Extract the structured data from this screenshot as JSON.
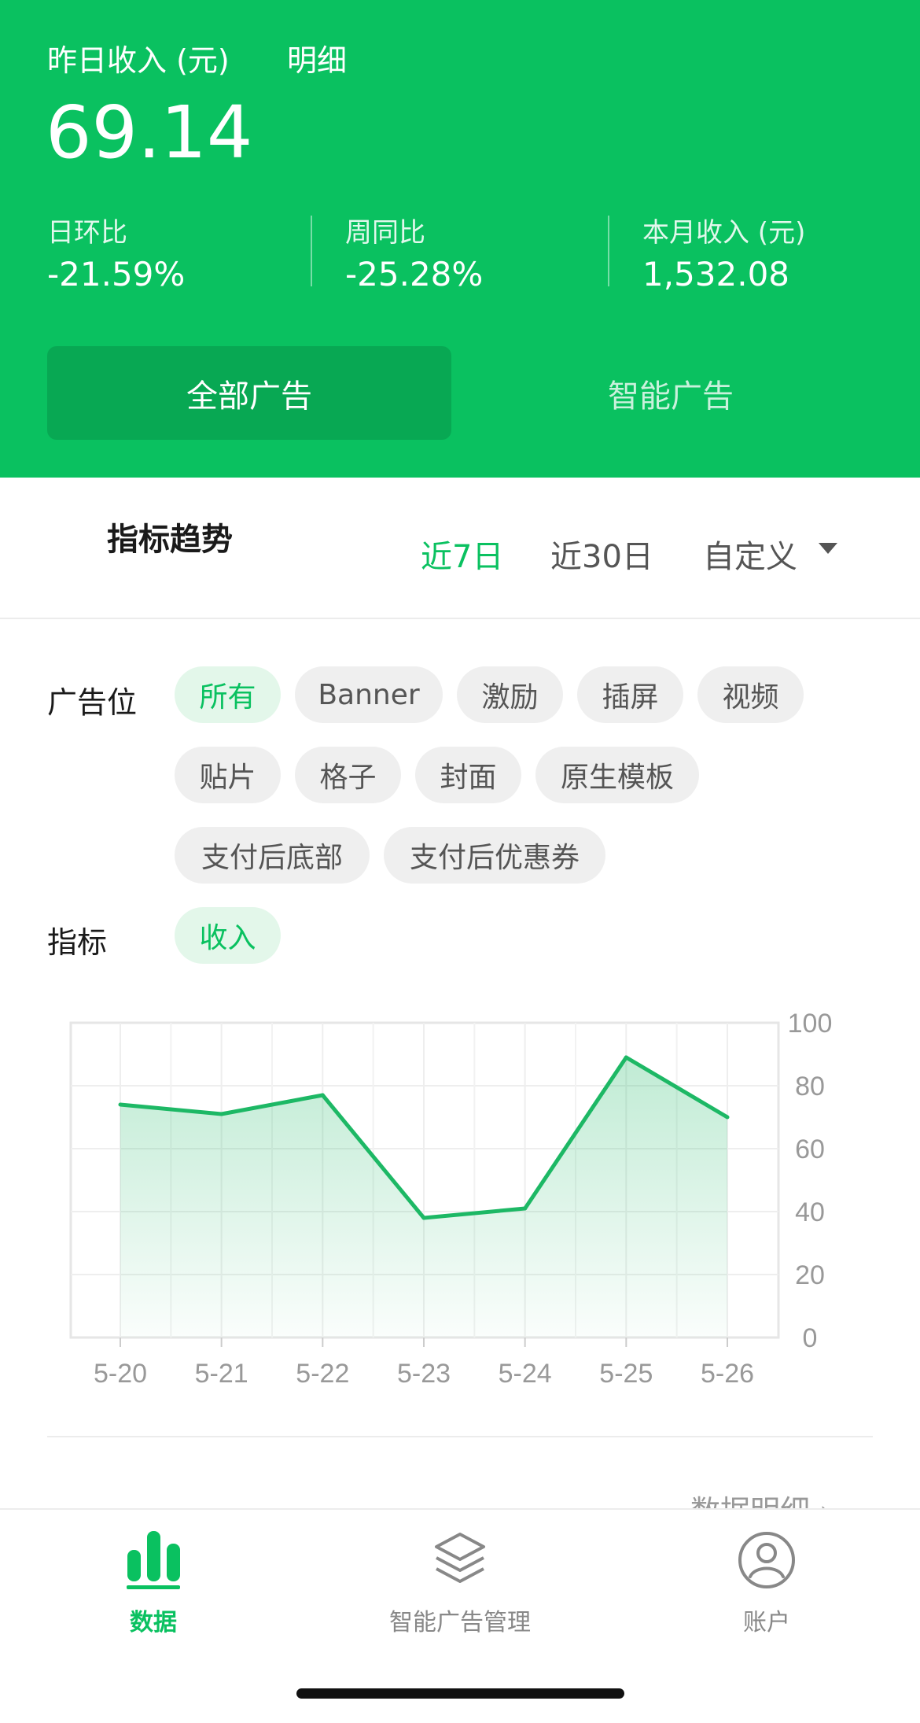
{
  "header": {
    "title": "昨日收入 (元)",
    "detail_link": "明细",
    "amount": "69.14",
    "stats": [
      {
        "label": "日环比",
        "value": "-21.59%"
      },
      {
        "label": "周同比",
        "value": "-25.28%"
      },
      {
        "label": "本月收入 (元)",
        "value": "1,532.08"
      }
    ],
    "tabs": {
      "active": "全部广告",
      "inactive": "智能广告"
    }
  },
  "trend": {
    "title": "指标趋势",
    "ranges": [
      "近7日",
      "近30日",
      "自定义"
    ],
    "active_range": "近7日"
  },
  "filters": {
    "placement_label": "广告位",
    "placements": [
      "所有",
      "Banner",
      "激励",
      "插屏",
      "视频",
      "贴片",
      "格子",
      "封面",
      "原生模板",
      "支付后底部",
      "支付后优惠券"
    ],
    "active_placement": "所有",
    "metric_label": "指标",
    "metrics": [
      "收入"
    ],
    "active_metric": "收入"
  },
  "chart_data": {
    "type": "area",
    "x": [
      "5-20",
      "5-21",
      "5-22",
      "5-23",
      "5-24",
      "5-25",
      "5-26"
    ],
    "series": [
      {
        "values": [
          74,
          71,
          77,
          38,
          41,
          89,
          70
        ]
      }
    ],
    "ylim": [
      0,
      100
    ],
    "yticks": [
      0,
      20,
      40,
      60,
      80,
      100
    ],
    "grid": true,
    "color": "#1db865"
  },
  "detail_footer": "数据明细 ›",
  "tabbar": {
    "items": [
      {
        "label": "数据",
        "icon": "bar-chart-icon",
        "active": true
      },
      {
        "label": "智能广告管理",
        "icon": "layers-icon",
        "active": false
      },
      {
        "label": "账户",
        "icon": "user-icon",
        "active": false
      }
    ]
  },
  "colors": {
    "brand": "#0ac160",
    "brand_dark": "#08a853",
    "chip_bg": "#efefef",
    "chip_active_bg": "#e3f7ea"
  }
}
